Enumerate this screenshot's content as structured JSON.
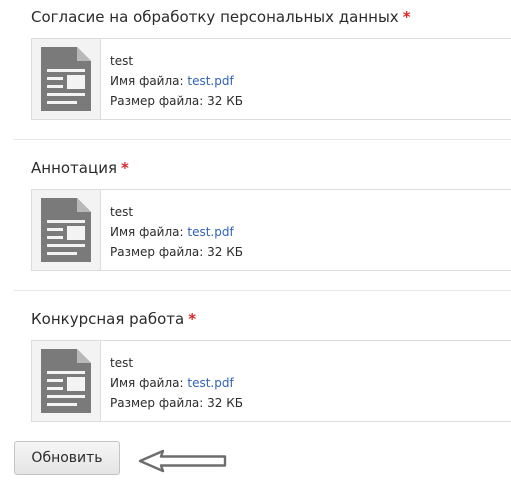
{
  "sections": [
    {
      "title": "Согласие на обработку персональных данных",
      "required_mark": "*",
      "file": {
        "name": "test",
        "filename_label": "Имя файла:",
        "filename": "test.pdf",
        "size_label": "Размер файла:",
        "size": "32 КБ"
      }
    },
    {
      "title": "Аннотация",
      "required_mark": "*",
      "file": {
        "name": "test",
        "filename_label": "Имя файла:",
        "filename": "test.pdf",
        "size_label": "Размер файла:",
        "size": "32 КБ"
      }
    },
    {
      "title": "Конкурсная работа",
      "required_mark": "*",
      "file": {
        "name": "test",
        "filename_label": "Имя файла:",
        "filename": "test.pdf",
        "size_label": "Размер файла:",
        "size": "32 КБ"
      }
    }
  ],
  "actions": {
    "update_label": "Обновить"
  },
  "icons": {
    "file": "document-icon",
    "pointer": "arrow-left-icon"
  },
  "colors": {
    "required": "#d9262a",
    "link": "#2f62b8",
    "icon": "#7a7a7a"
  }
}
